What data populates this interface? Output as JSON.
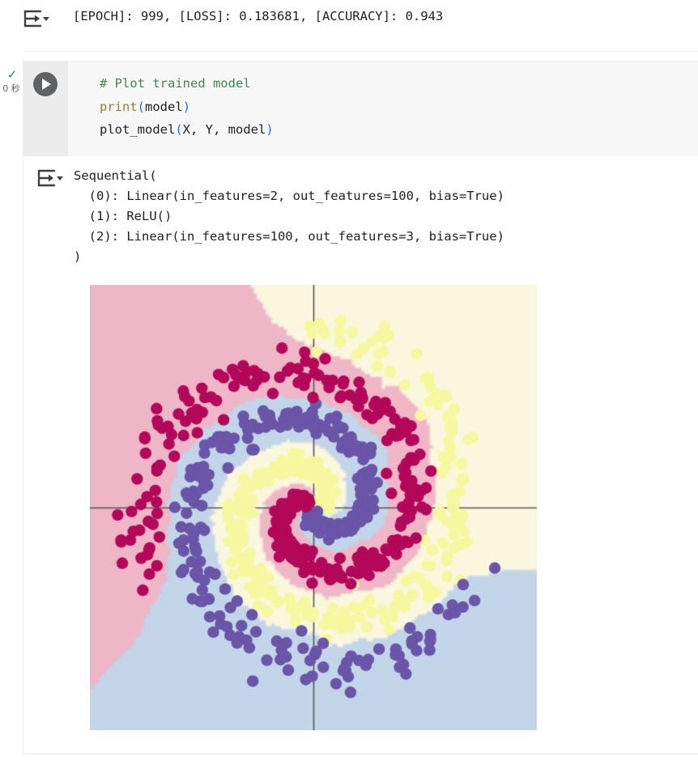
{
  "notebook": {
    "epoch_output": {
      "icon": "output-arrow-icon",
      "text": "[EPOCH]: 999, [LOSS]: 0.183681, [ACCURACY]: 0.943"
    },
    "code_cell": {
      "run_icon": "play-icon",
      "exec_status": {
        "check_icon": "✓",
        "time_label": "0 秒"
      },
      "lines": [
        {
          "parts": [
            {
              "t": "# Plot trained model",
              "c": "tok-comment"
            }
          ]
        },
        {
          "parts": [
            {
              "t": "print",
              "c": "tok-func"
            },
            {
              "t": "(",
              "c": "tok-paren"
            },
            {
              "t": "model",
              "c": "tok-plain"
            },
            {
              "t": ")",
              "c": "tok-paren"
            }
          ]
        },
        {
          "parts": [
            {
              "t": "plot_model",
              "c": "tok-plain"
            },
            {
              "t": "(",
              "c": "tok-paren"
            },
            {
              "t": "X, Y, model",
              "c": "tok-plain"
            },
            {
              "t": ")",
              "c": "tok-paren"
            }
          ]
        }
      ]
    },
    "model_output": {
      "icon": "output-arrow-icon",
      "text": "Sequential(\n  (0): Linear(in_features=2, out_features=100, bias=True)\n  (1): ReLU()\n  (2): Linear(in_features=100, out_features=3, bias=True)\n)"
    }
  },
  "chart_data": {
    "type": "scatter",
    "title": "",
    "xlabel": "",
    "ylabel": "",
    "xlim": [
      -1.3,
      1.3
    ],
    "ylim": [
      -1.3,
      1.3
    ],
    "grid": false,
    "legend": null,
    "description": "Three-arm spiral classification with decision-boundary background regions",
    "axes": {
      "x_axis_line_y": 0,
      "y_axis_line_x": 0,
      "axis_color": "#555555"
    },
    "class_colors": {
      "class0_points": "#b3085a",
      "class0_region": "#eeb6c6",
      "class1_points": "#6a55a8",
      "class1_region": "#c3d5e8",
      "class2_points": "#f7f7a0",
      "class2_region": "#fbf7df"
    },
    "series": [
      {
        "name": "class 0 (crimson spiral)",
        "color": "#b3085a",
        "n_points": 300
      },
      {
        "name": "class 1 (purple spiral)",
        "color": "#6a55a8",
        "n_points": 300
      },
      {
        "name": "class 2 (yellow spiral)",
        "color": "#f7f7a0",
        "n_points": 300
      }
    ],
    "spiral": {
      "arms": 3,
      "points_per_arm": 300,
      "turns": 1.22,
      "noise": 0.055,
      "arm_phase_offsets_deg": [
        0,
        120,
        240
      ],
      "base_angle_deg": 128,
      "radius_max": 1.05
    }
  }
}
